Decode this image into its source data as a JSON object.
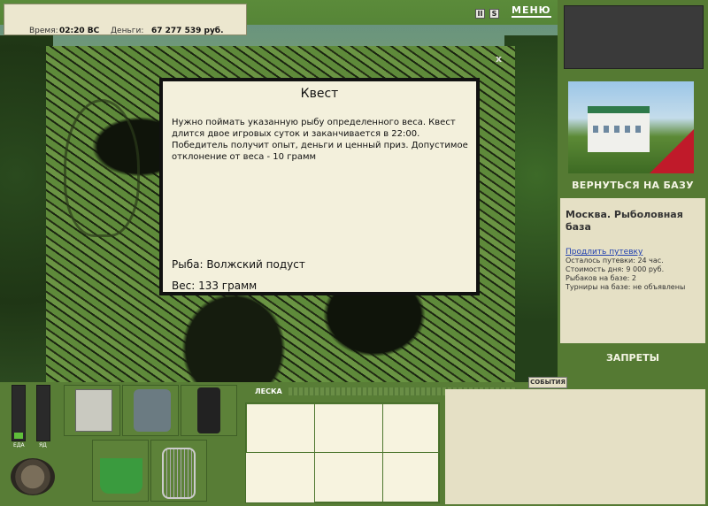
{
  "top": {
    "time_label": "Время:",
    "time_value": "02:20 ВС",
    "money_label": "Деньги:",
    "money_value": "67 277 539 руб.",
    "pause_icon": "pause-icon",
    "sound_icon": "sound-icon",
    "sound_glyph": "S",
    "pause_glyph": "II",
    "menu_label": "МЕНЮ"
  },
  "quest": {
    "close_label": "x",
    "title": "Квест",
    "description": "Нужно поймать указанную рыбу определенного веса. Квест длится двое игровых суток и заканчивается в 22:00. Победитель получит опыт, деньги и ценный приз. Допустимое отклонение от веса - 10 грамм",
    "fish_line": "Рыба: Волжский подуст",
    "weight_line": "Вес: 133 грамм"
  },
  "sidebar": {
    "back_label": "ВЕРНУТЬСЯ НА БАЗУ",
    "place": "Москва. Рыболовная база",
    "extend_link": "Продлить путевку",
    "rows": [
      "Осталось путевки: 24 час.",
      "Стоимость дня: 9 000 руб.",
      "Рыбаков на базе: 2",
      "Турниры на базе: не объявлены"
    ],
    "bans_label": "ЗАПРЕТЫ"
  },
  "bottom": {
    "food_label": "ЕДА",
    "poison_label": "ЯД",
    "food_level": 0.12,
    "leska_label": "ЛЕСКА",
    "events_label": "СОБЫТИЯ"
  },
  "colors": {
    "panel_green": "#587d36",
    "paper": "#f3f0dc",
    "accent_red": "#c01a2a"
  }
}
